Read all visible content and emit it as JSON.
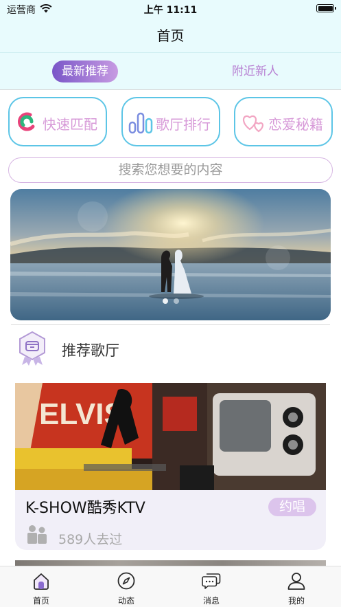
{
  "status_bar": {
    "carrier": "运营商",
    "time": "上午 11:11"
  },
  "nav": {
    "title": "首页"
  },
  "segment_tabs": [
    {
      "label": "最新推荐",
      "active": true
    },
    {
      "label": "附近新人",
      "active": false
    }
  ],
  "quick_actions": [
    {
      "label": "快速匹配",
      "icon": "quick-match-icon"
    },
    {
      "label": "歌厅排行",
      "icon": "bar-ranking-icon"
    },
    {
      "label": "恋爱秘籍",
      "icon": "hearts-icon"
    }
  ],
  "search": {
    "placeholder": "搜索您想要的内容"
  },
  "banner": {
    "image": "couple-kissing-at-sunset-on-lake-photo",
    "page_count": 2,
    "current_page": 1
  },
  "section": {
    "title": "推荐歌厅",
    "icon": "venue-badge-icon"
  },
  "venues": [
    {
      "name": "K-SHOW酷秀KTV",
      "action_label": "约唱",
      "visits": "589人去过",
      "image": "ktv-room-retro-tv-decor-photo"
    }
  ],
  "tab_bar": [
    {
      "label": "首页",
      "icon": "home-icon",
      "active": true
    },
    {
      "label": "动态",
      "icon": "compass-icon",
      "active": false
    },
    {
      "label": "消息",
      "icon": "message-bubbles-icon",
      "active": false
    },
    {
      "label": "我的",
      "icon": "profile-icon",
      "active": false
    }
  ],
  "colors": {
    "header_bg": "#e8fbfd",
    "accent_purple": "#7a56c8",
    "label_pink": "#d79ad8",
    "button_border": "#5cc5e6",
    "card_bg": "#f1eff8"
  }
}
